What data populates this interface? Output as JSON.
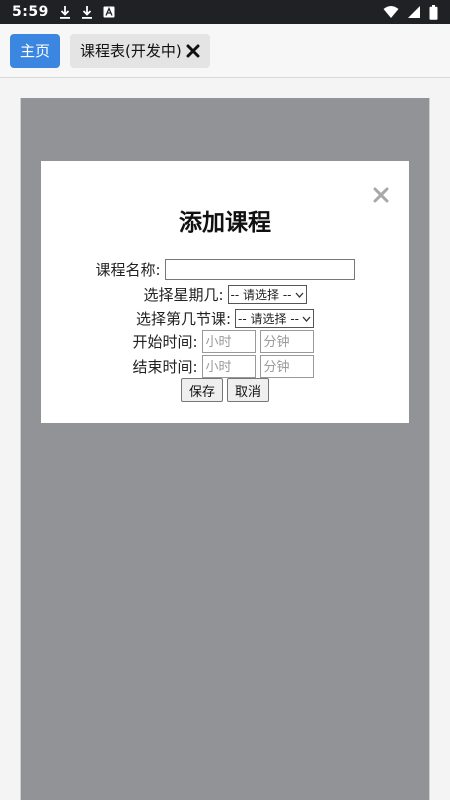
{
  "statusbar": {
    "time": "5:59",
    "icons": [
      "download-icon",
      "download-icon",
      "app-notification-icon",
      "wifi-icon",
      "signal-icon",
      "battery-icon"
    ]
  },
  "tabs": {
    "home_label": "主页",
    "schedule_label": "课程表(开发中)"
  },
  "modal": {
    "title": "添加课程",
    "course_name_label": "课程名称:",
    "course_name_value": "",
    "weekday_label": "选择星期几:",
    "weekday_selected": "-- 请选择 --",
    "period_label": "选择第几节课:",
    "period_selected": "-- 请选择 --",
    "start_label": "开始时间:",
    "end_label": "结束时间:",
    "hour_placeholder": "小时",
    "minute_placeholder": "分钟",
    "save_label": "保存",
    "cancel_label": "取消"
  },
  "colors": {
    "accent": "#3b86e0",
    "overlay": "#929396",
    "statusbar": "#202124"
  }
}
